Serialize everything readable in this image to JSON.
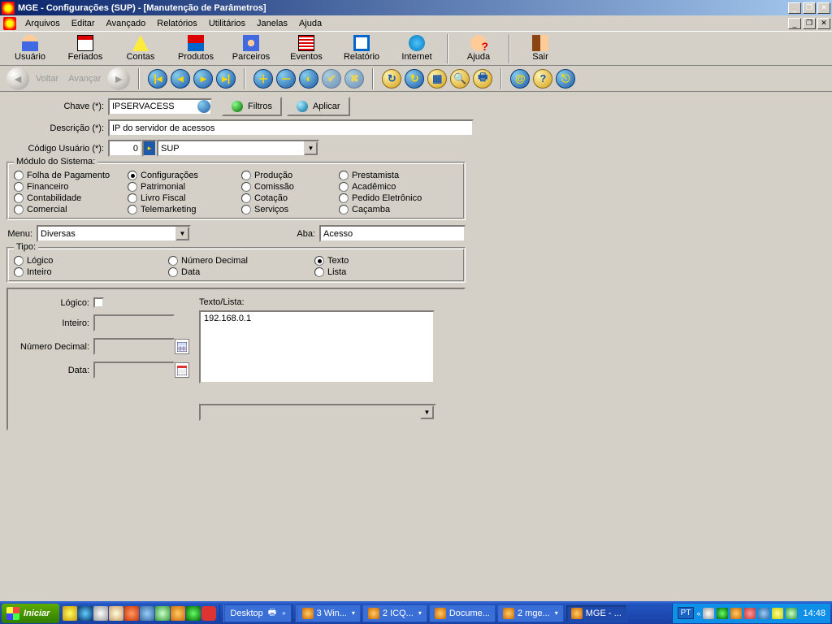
{
  "title": "MGE - Configurações (SUP) - [Manutenção de Parâmetros]",
  "menubar": [
    "Arquivos",
    "Editar",
    "Avançado",
    "Relatórios",
    "Utilitários",
    "Janelas",
    "Ajuda"
  ],
  "toolbar1": [
    {
      "label": "Usuário",
      "icon": "ic-usuario"
    },
    {
      "label": "Feriados",
      "icon": "ic-feriados"
    },
    {
      "label": "Contas",
      "icon": "ic-contas"
    },
    {
      "label": "Produtos",
      "icon": "ic-produtos"
    },
    {
      "label": "Parceiros",
      "icon": "ic-parceiros"
    },
    {
      "label": "Eventos",
      "icon": "ic-eventos"
    },
    {
      "label": "Relatório",
      "icon": "ic-relatorio"
    },
    {
      "label": "Internet",
      "icon": "ic-internet"
    },
    {
      "label": "Ajuda",
      "icon": "ic-ajuda"
    },
    {
      "label": "Sair",
      "icon": "ic-sair"
    }
  ],
  "nav": {
    "back": "Voltar",
    "forward": "Avançar"
  },
  "btn": {
    "filtros": "Filtros",
    "aplicar": "Aplicar"
  },
  "labels": {
    "chave": "Chave (*):",
    "descricao": "Descrição (*):",
    "codusuario": "Código Usuário (*):",
    "menu": "Menu:",
    "aba": "Aba:",
    "logico": "Lógico:",
    "inteiro": "Inteiro:",
    "numdec": "Número Decimal:",
    "data": "Data:",
    "textolista": "Texto/Lista:"
  },
  "fields": {
    "chave": "IPSERVACESS",
    "descricao": "IP do servidor de acessos",
    "codusuario_num": "0",
    "codusuario_txt": "SUP",
    "menu": "Diversas",
    "aba": "Acesso",
    "inteiro": "",
    "numdec": "",
    "data": "",
    "textolista": "192.168.0.1"
  },
  "group_modulo": {
    "title": "Módulo do Sistema:",
    "items": [
      "Folha de Pagamento",
      "Configurações",
      "Produção",
      "Prestamista",
      "Financeiro",
      "Patrimonial",
      "Comissão",
      "Acadêmico",
      "Contabilidade",
      "Livro Fiscal",
      "Cotação",
      "Pedido Eletrônico",
      "Comercial",
      "Telemarketing",
      "Serviços",
      "Caçamba"
    ],
    "selected": "Configurações"
  },
  "group_tipo": {
    "title": "Tipo:",
    "items": [
      "Lógico",
      "Número Decimal",
      "Texto",
      "Inteiro",
      "Data",
      "Lista"
    ],
    "selected": "Texto"
  },
  "taskbar": {
    "start": "Iniciar",
    "desktop": "Desktop",
    "tasks": [
      {
        "label": "3 Win...",
        "active": false,
        "dd": true
      },
      {
        "label": "2 ICQ...",
        "active": false,
        "dd": true
      },
      {
        "label": "Docume...",
        "active": false
      },
      {
        "label": "2 mge...",
        "active": false,
        "dd": true
      },
      {
        "label": "MGE - ...",
        "active": true
      }
    ],
    "lang": "PT",
    "clock": "14:48"
  }
}
